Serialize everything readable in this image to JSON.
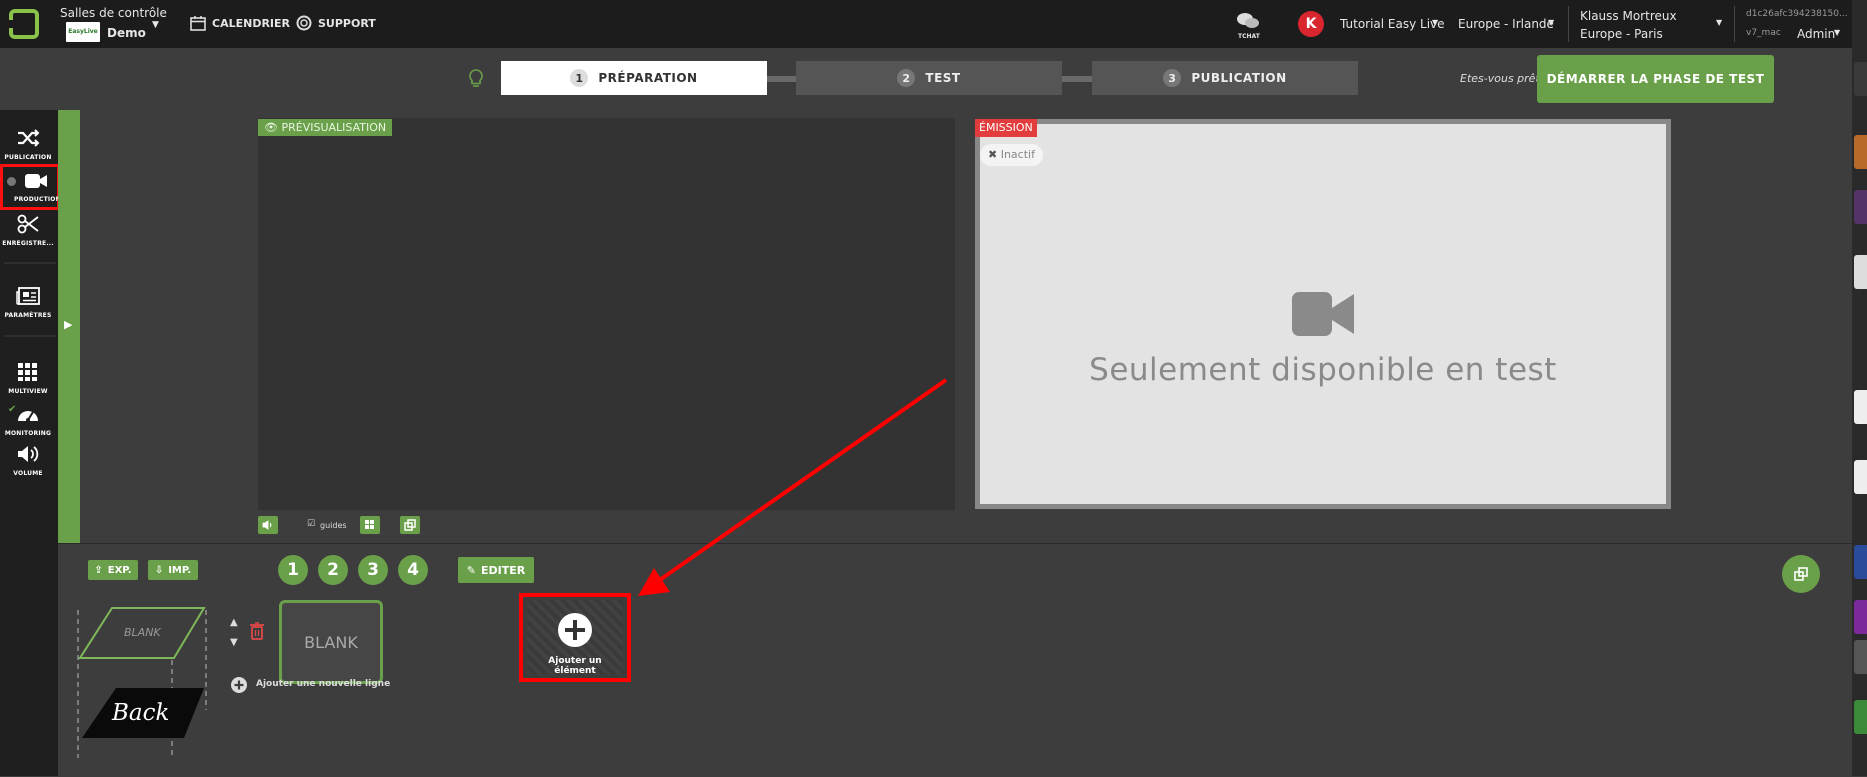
{
  "topbar": {
    "control_rooms_label": "Salles de contrôle",
    "room_name": "Demo",
    "logo_text": "EasyLive",
    "calendar": "CALENDRIER",
    "support": "SUPPORT",
    "chat": "TCHAT",
    "avatar_letter": "K",
    "tutorial": "Tutorial Easy Live",
    "region": "Europe - Irlande",
    "user_name": "Klauss Mortreux",
    "user_tz": "Europe - Paris",
    "session_id": "d1c26afc394238150...",
    "version": "v7_mac",
    "role": "Admin"
  },
  "steps": [
    {
      "num": "1",
      "label": "PRÉPARATION"
    },
    {
      "num": "2",
      "label": "TEST"
    },
    {
      "num": "3",
      "label": "PUBLICATION"
    }
  ],
  "ready_text": "Etes-vous prêt",
  "start_button": "DÉMARRER LA PHASE DE TEST",
  "sidebar": [
    {
      "label": "PUBLICATION"
    },
    {
      "label": "PRODUCTION"
    },
    {
      "label": "ENREGISTRE..."
    },
    {
      "label": "PARAMÈTRES"
    },
    {
      "label": "MULTIVIEW"
    },
    {
      "label": "MONITORING"
    },
    {
      "label": "VOLUME"
    }
  ],
  "preview_label": "PRÉVISUALISATION",
  "emission_label": "ÉMISSION",
  "inactive_label": "Inactif",
  "emission_message": "Seulement disponible en test",
  "guides_label": "guides",
  "lower": {
    "export": "EXP.",
    "import": "IMP.",
    "numbers": [
      "1",
      "2",
      "3",
      "4"
    ],
    "edit": "EDITER",
    "blank_thumb": "BLANK",
    "blank_card": "BLANK",
    "back_label": "Back",
    "add_line": "Ajouter une nouvelle ligne",
    "add_element": "Ajouter un élément"
  },
  "colors": {
    "accent": "#6aa04a",
    "danger": "#e23c3c",
    "highlight": "#ff0000"
  }
}
